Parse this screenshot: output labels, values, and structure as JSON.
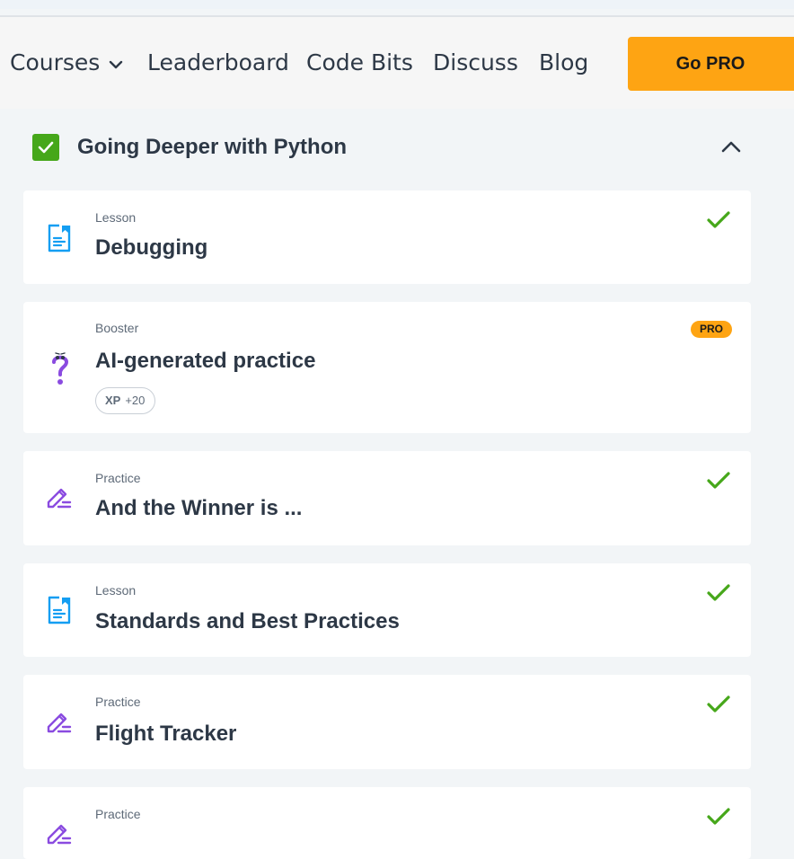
{
  "nav": {
    "items": [
      "Courses",
      "Leaderboard",
      "Code Bits",
      "Discuss",
      "Blog"
    ],
    "cta": "Go PRO"
  },
  "section": {
    "title": "Going Deeper with Python",
    "completed": true,
    "expanded": true
  },
  "lessons": [
    {
      "kind": "Lesson",
      "title": "Debugging",
      "icon": "lesson-icon",
      "completed": true
    },
    {
      "kind": "Booster",
      "title": "AI-generated practice",
      "icon": "question-mark-icon",
      "pro": true,
      "pro_label": "PRO",
      "xp_label": "XP",
      "xp_value": "+20"
    },
    {
      "kind": "Practice",
      "title": "And the Winner is ...",
      "icon": "pencil-icon",
      "completed": true
    },
    {
      "kind": "Lesson",
      "title": "Standards and Best Practices",
      "icon": "lesson-icon",
      "completed": true
    },
    {
      "kind": "Practice",
      "title": "Flight Tracker",
      "icon": "pencil-icon",
      "completed": true
    },
    {
      "kind": "Practice",
      "title": "",
      "icon": "pencil-icon",
      "completed": true
    }
  ],
  "colors": {
    "accent_orange": "#fea413",
    "check_green": "#46a71a",
    "lesson_blue": "#149ef2",
    "practice_purple": "#8a4be0",
    "text_dark": "#2d3846"
  }
}
